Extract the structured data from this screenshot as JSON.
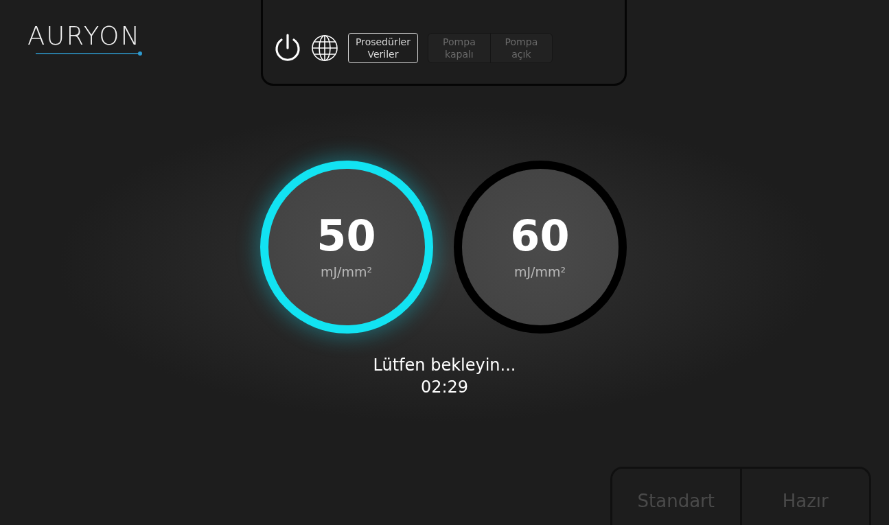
{
  "logo": {
    "text": "AURYON"
  },
  "toolbar": {
    "procedures_button": {
      "lines": [
        "Prosedürler",
        "Veriler"
      ]
    },
    "pump_buttons": [
      {
        "lines": [
          "Pompa",
          "kapalı"
        ],
        "disabled": true
      },
      {
        "lines": [
          "Pompa",
          "açık"
        ],
        "disabled": true
      }
    ]
  },
  "dials": [
    {
      "value": "50",
      "unit": "mJ/mm²",
      "selected": true
    },
    {
      "value": "60",
      "unit": "mJ/mm²",
      "selected": false
    }
  ],
  "status": {
    "message": "Lütfen bekleyin...",
    "timer": "02:29"
  },
  "mode_buttons": [
    {
      "label": "Standart",
      "disabled": true
    },
    {
      "label": "Hazır",
      "disabled": true
    }
  ]
}
